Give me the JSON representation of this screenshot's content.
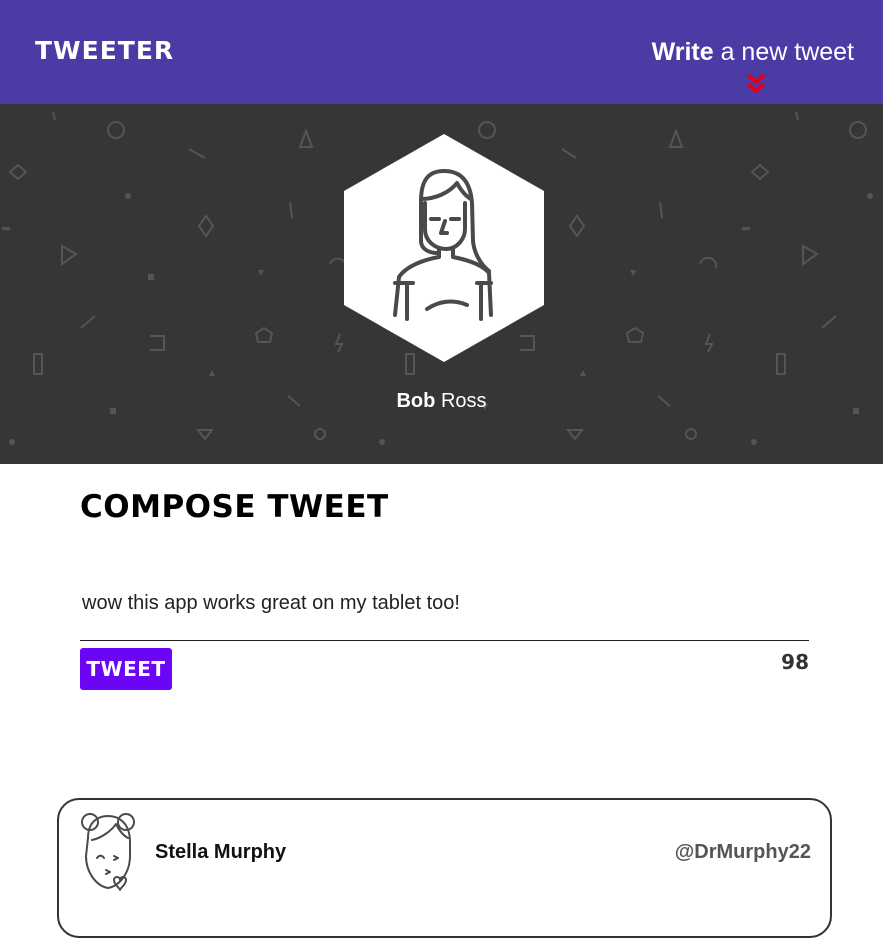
{
  "nav": {
    "brand": "TWEETER",
    "write_bold": "Write",
    "write_rest": " a new tweet",
    "chevron_icon": "double-chevron-down-icon",
    "chevron_color": "#e0001b"
  },
  "profile": {
    "first_name": "Bob",
    "last_name": "Ross",
    "avatar_icon": "woman-avatar-icon"
  },
  "compose": {
    "title": "COMPOSE TWEET",
    "text": "wow this app works great on my tablet too!",
    "button_label": "TWEET",
    "char_count": "98"
  },
  "tweets": [
    {
      "name": "Stella Murphy",
      "handle": "@DrMurphy22",
      "avatar_icon": "woman-kissing-avatar-icon"
    }
  ],
  "colors": {
    "nav_bg": "#4b3ba5",
    "header_bg": "#363636",
    "button_bg": "#6a05f6"
  }
}
